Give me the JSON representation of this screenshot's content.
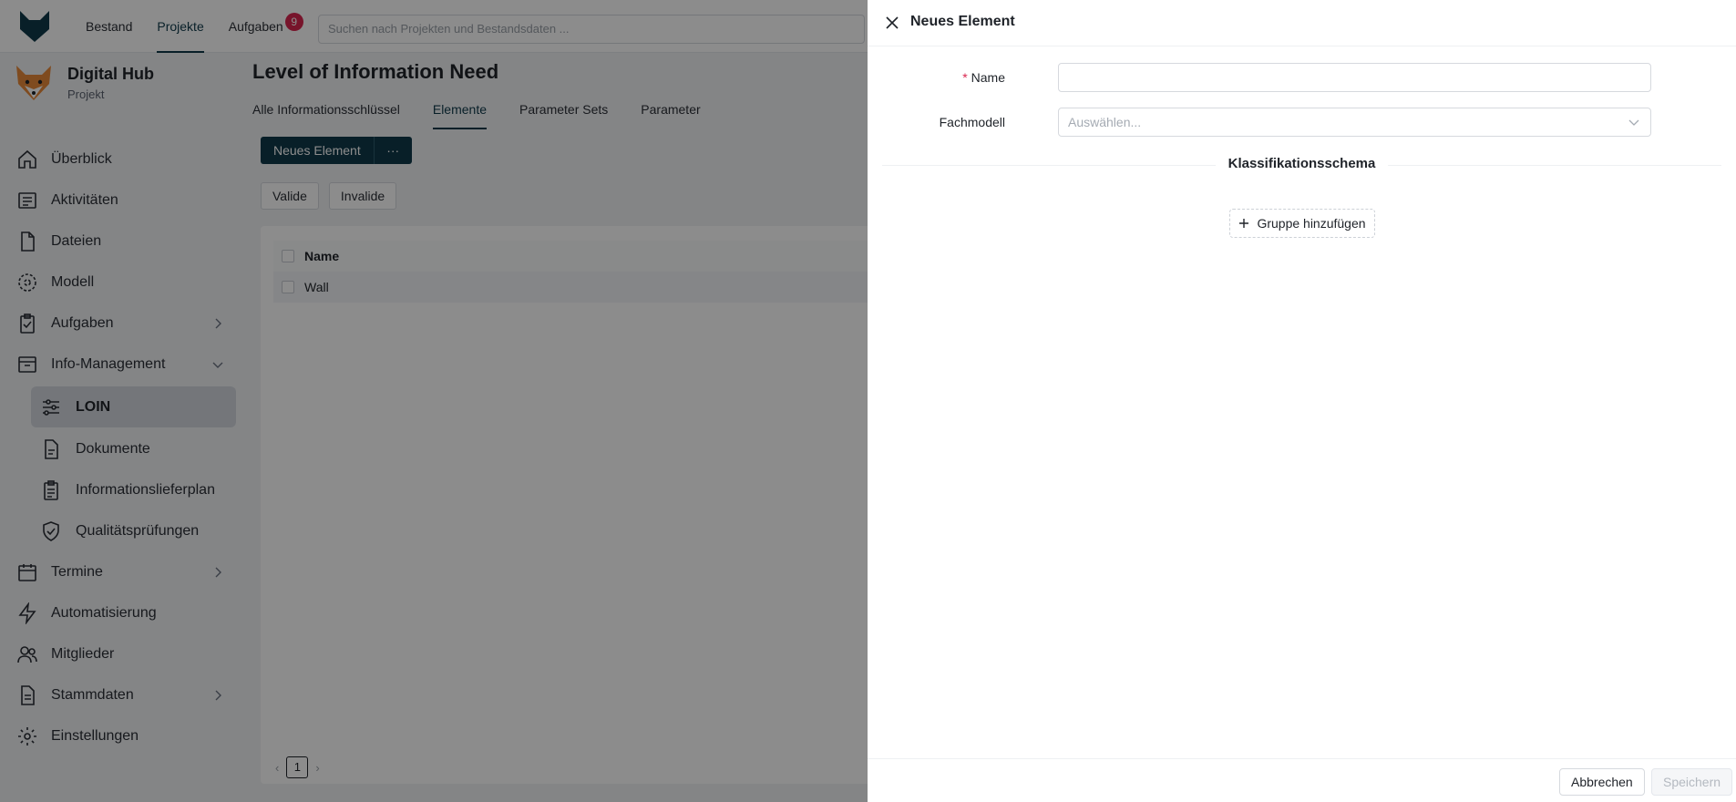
{
  "topbar": {
    "nav": [
      {
        "label": "Bestand"
      },
      {
        "label": "Projekte"
      },
      {
        "label": "Aufgaben",
        "badge": "9"
      }
    ],
    "search_placeholder": "Suchen nach Projekten und Bestandsdaten ..."
  },
  "project": {
    "name": "Digital Hub",
    "subtitle": "Projekt"
  },
  "sidebar": {
    "items": [
      {
        "label": "Überblick"
      },
      {
        "label": "Aktivitäten"
      },
      {
        "label": "Dateien"
      },
      {
        "label": "Modell"
      },
      {
        "label": "Aufgaben"
      },
      {
        "label": "Info-Management"
      },
      {
        "label": "LOIN"
      },
      {
        "label": "Dokumente"
      },
      {
        "label": "Informationslieferplan"
      },
      {
        "label": "Qualitätsprüfungen"
      },
      {
        "label": "Termine"
      },
      {
        "label": "Automatisierung"
      },
      {
        "label": "Mitglieder"
      },
      {
        "label": "Stammdaten"
      },
      {
        "label": "Einstellungen"
      }
    ]
  },
  "page": {
    "title": "Level of Information Need",
    "tabs": [
      {
        "label": "Alle Informationsschlüssel"
      },
      {
        "label": "Elemente"
      },
      {
        "label": "Parameter Sets"
      },
      {
        "label": "Parameter"
      }
    ],
    "new_button": "Neues Element",
    "more_button": "···",
    "filters": [
      {
        "label": "Valide"
      },
      {
        "label": "Invalide"
      }
    ],
    "table": {
      "header": "Name",
      "rows": [
        "Wall"
      ]
    },
    "pager": {
      "page": "1"
    }
  },
  "drawer": {
    "title": "Neues Element",
    "name_label": "Name",
    "required_mark": "*",
    "name_value": "",
    "fachmodell_label": "Fachmodell",
    "fachmodell_placeholder": "Auswählen...",
    "section_title": "Klassifikationsschema",
    "add_group": "Gruppe hinzufügen",
    "cancel": "Abbrechen",
    "save": "Speichern"
  },
  "colors": {
    "primary": "#0f3a4a",
    "badge": "#d9264f",
    "active_item": "#d3d8df"
  }
}
